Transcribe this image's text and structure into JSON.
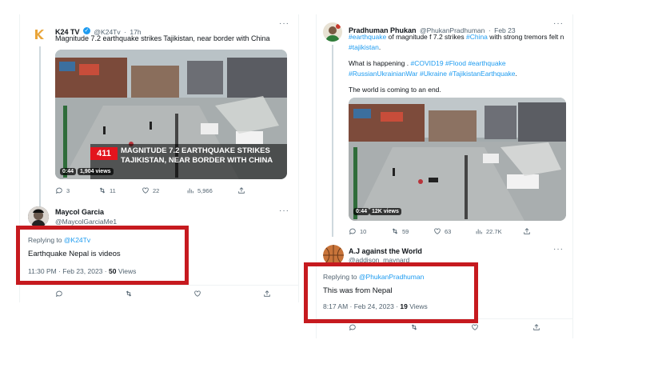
{
  "left": {
    "tweet": {
      "name": "K24 TV",
      "handle": "@K24Tv",
      "time": "17h",
      "text": "Magnitude 7.2 earthquake strikes Tajikistan, near border with China",
      "caption_number": "411",
      "caption_line1": "MAGNITUDE 7.2 EARTHQUAKE STRIKES",
      "caption_line2": "TAJIKISTAN, NEAR BORDER WITH CHINA",
      "video_time": "0:44",
      "video_views": "1,904 views",
      "replies": "3",
      "retweets": "11",
      "likes": "22",
      "views": "5,966"
    },
    "reply": {
      "name": "Maycol Garcia",
      "handle": "@MaycolGarciaMe1",
      "replying_prefix": "Replying to",
      "replying_to": "@K24Tv",
      "text": "Earthquake Nepal is videos",
      "timestamp": "11:30 PM · Feb 23, 2023 ·",
      "view_count": "50",
      "views_label": "Views"
    }
  },
  "right": {
    "tweet": {
      "name": "Pradhuman Phukan",
      "handle": "@PhukanPradhuman",
      "time": "Feb 23",
      "line1_tag": "#earthquake",
      "line1_mid": " of magnitude f 7.2 strikes ",
      "line1_tag2": "#China",
      "line1_end": " with strong tremors felt n",
      "line2_tag": "#tajikistan",
      "line2_end": ".",
      "line3_start": "What is happening . ",
      "line3_tags": "#COVID19 #Flood #earthquake",
      "line4_tags": "#RussianUkrainianWar #Ukraine #TajikistanEarthquake",
      "line4_end": ".",
      "line5": "The world is coming to an end.",
      "video_time": "0:44",
      "video_views": "12K views",
      "replies": "10",
      "retweets": "59",
      "likes": "63",
      "views": "22.7K"
    },
    "reply": {
      "name": "A.J against the World",
      "handle": "@addison_maynard",
      "replying_prefix": "Replying to",
      "replying_to": "@PhukanPradhuman",
      "text": "This was from Nepal",
      "timestamp": "8:17 AM · Feb 24, 2023 ·",
      "view_count": "19",
      "views_label": "Views"
    }
  },
  "colors": {
    "highlight": "#c61a1f",
    "link": "#1d9bf0",
    "caption_red": "#e3141d"
  }
}
